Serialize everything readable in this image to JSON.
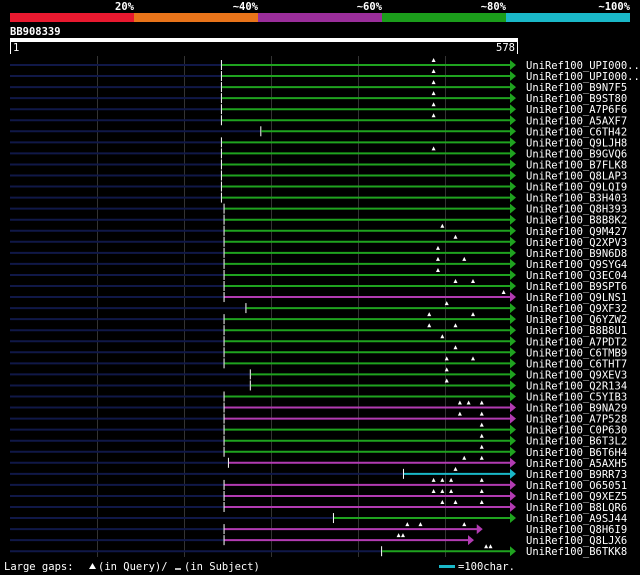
{
  "legend": {
    "ticks": [
      {
        "label": "20%",
        "color": "#e8192f"
      },
      {
        "label": "~40%",
        "color": "#e8741a"
      },
      {
        "label": "~60%",
        "color": "#9b2e9b"
      },
      {
        "label": "~80%",
        "color": "#1b9d1b"
      },
      {
        "label": "~100%",
        "color": "#1ab8c8"
      }
    ]
  },
  "query": {
    "name": "BB908339",
    "start": "1",
    "end": "578"
  },
  "footer": {
    "gaps_label": "Large gaps:",
    "in_query": "(in Query)/",
    "in_subject": "(in Subject)",
    "scale_label": "=100char.",
    "scale_color": "#1ab8c8"
  },
  "colors": {
    "green": "#1fa31f",
    "magenta": "#b23bb2",
    "cyan": "#1ab8c8",
    "navy": "#101848",
    "grid": "#333"
  },
  "chart_data": {
    "type": "alignment",
    "query_length": 578,
    "hits": [
      {
        "name": "UniRef100_UPI000..",
        "start": 242,
        "end": 578,
        "color": "green",
        "gaps": [
          485
        ]
      },
      {
        "name": "UniRef100_UPI000..",
        "start": 242,
        "end": 578,
        "color": "green",
        "gaps": [
          485
        ]
      },
      {
        "name": "UniRef100_B9N7F5",
        "start": 242,
        "end": 578,
        "color": "green",
        "gaps": [
          485
        ]
      },
      {
        "name": "UniRef100_B9ST80",
        "start": 242,
        "end": 578,
        "color": "green",
        "gaps": [
          485
        ]
      },
      {
        "name": "UniRef100_A7P6F6",
        "start": 242,
        "end": 578,
        "color": "green",
        "gaps": [
          485
        ]
      },
      {
        "name": "UniRef100_A5AXF7",
        "start": 242,
        "end": 578,
        "color": "green",
        "gaps": [
          485
        ]
      },
      {
        "name": "UniRef100_C6TH42",
        "start": 287,
        "end": 578,
        "color": "green",
        "gaps": []
      },
      {
        "name": "UniRef100_Q9LJH8",
        "start": 242,
        "end": 578,
        "color": "green",
        "gaps": []
      },
      {
        "name": "UniRef100_B9GVQ6",
        "start": 242,
        "end": 578,
        "color": "green",
        "gaps": [
          485
        ]
      },
      {
        "name": "UniRef100_B7FLK8",
        "start": 242,
        "end": 578,
        "color": "green",
        "gaps": []
      },
      {
        "name": "UniRef100_Q8LAP3",
        "start": 242,
        "end": 578,
        "color": "green",
        "gaps": []
      },
      {
        "name": "UniRef100_Q9LQI9",
        "start": 242,
        "end": 578,
        "color": "green",
        "gaps": []
      },
      {
        "name": "UniRef100_B3H403",
        "start": 242,
        "end": 578,
        "color": "green",
        "gaps": []
      },
      {
        "name": "UniRef100_Q8H393",
        "start": 245,
        "end": 578,
        "color": "green",
        "gaps": []
      },
      {
        "name": "UniRef100_B8B8K2",
        "start": 245,
        "end": 578,
        "color": "green",
        "gaps": []
      },
      {
        "name": "UniRef100_Q9M427",
        "start": 245,
        "end": 578,
        "color": "green",
        "gaps": [
          495
        ]
      },
      {
        "name": "UniRef100_Q2XPV3",
        "start": 245,
        "end": 578,
        "color": "green",
        "gaps": [
          510
        ]
      },
      {
        "name": "UniRef100_B9N6D8",
        "start": 245,
        "end": 578,
        "color": "green",
        "gaps": [
          490
        ]
      },
      {
        "name": "UniRef100_Q9SYG4",
        "start": 245,
        "end": 578,
        "color": "green",
        "gaps": [
          490,
          520
        ]
      },
      {
        "name": "UniRef100_Q3EC04",
        "start": 245,
        "end": 578,
        "color": "green",
        "gaps": [
          490
        ]
      },
      {
        "name": "UniRef100_B9SPT6",
        "start": 245,
        "end": 578,
        "color": "green",
        "gaps": [
          510,
          530
        ]
      },
      {
        "name": "UniRef100_Q9LNS1",
        "start": 245,
        "end": 578,
        "color": "magenta",
        "gaps": [
          565
        ]
      },
      {
        "name": "UniRef100_Q9XF32",
        "start": 270,
        "end": 578,
        "color": "green",
        "gaps": [
          500
        ]
      },
      {
        "name": "UniRef100_Q6YZW2",
        "start": 245,
        "end": 578,
        "color": "green",
        "gaps": [
          480,
          530
        ]
      },
      {
        "name": "UniRef100_B8B8U1",
        "start": 245,
        "end": 578,
        "color": "green",
        "gaps": [
          480,
          510
        ]
      },
      {
        "name": "UniRef100_A7PDT2",
        "start": 245,
        "end": 578,
        "color": "green",
        "gaps": [
          495
        ]
      },
      {
        "name": "UniRef100_C6TMB9",
        "start": 245,
        "end": 578,
        "color": "green",
        "gaps": [
          510
        ]
      },
      {
        "name": "UniRef100_C6THT7",
        "start": 245,
        "end": 578,
        "color": "green",
        "gaps": [
          500,
          530
        ]
      },
      {
        "name": "UniRef100_Q9XEV3",
        "start": 275,
        "end": 578,
        "color": "green",
        "gaps": [
          500
        ]
      },
      {
        "name": "UniRef100_Q2R134",
        "start": 275,
        "end": 578,
        "color": "green",
        "gaps": [
          500
        ]
      },
      {
        "name": "UniRef100_C5YIB3",
        "start": 245,
        "end": 578,
        "color": "green",
        "gaps": []
      },
      {
        "name": "UniRef100_B9NA29",
        "start": 245,
        "end": 578,
        "color": "magenta",
        "gaps": [
          515,
          525,
          540
        ]
      },
      {
        "name": "UniRef100_A7P528",
        "start": 245,
        "end": 578,
        "color": "magenta",
        "gaps": [
          515,
          540
        ]
      },
      {
        "name": "UniRef100_C0P630",
        "start": 245,
        "end": 578,
        "color": "green",
        "gaps": [
          540
        ]
      },
      {
        "name": "UniRef100_B6T3L2",
        "start": 245,
        "end": 578,
        "color": "green",
        "gaps": [
          540
        ]
      },
      {
        "name": "UniRef100_B6T6H4",
        "start": 245,
        "end": 578,
        "color": "green",
        "gaps": [
          540
        ]
      },
      {
        "name": "UniRef100_A5AXH5",
        "start": 250,
        "end": 578,
        "color": "magenta",
        "gaps": [
          520,
          540
        ]
      },
      {
        "name": "UniRef100_B9RR73",
        "start": 450,
        "end": 578,
        "color": "cyan",
        "gaps": [
          510
        ]
      },
      {
        "name": "UniRef100_O65051",
        "start": 245,
        "end": 578,
        "color": "magenta",
        "gaps": [
          485,
          495,
          505,
          540
        ]
      },
      {
        "name": "UniRef100_Q9XEZ5",
        "start": 245,
        "end": 578,
        "color": "magenta",
        "gaps": [
          485,
          495,
          505,
          540
        ]
      },
      {
        "name": "UniRef100_B8LQR6",
        "start": 245,
        "end": 578,
        "color": "magenta",
        "gaps": [
          495,
          510,
          540
        ]
      },
      {
        "name": "UniRef100_A9SJ44",
        "start": 370,
        "end": 578,
        "color": "green",
        "gaps": []
      },
      {
        "name": "UniRef100_Q8H6I9",
        "start": 245,
        "end": 540,
        "color": "magenta",
        "gaps": [
          455,
          470,
          520
        ]
      },
      {
        "name": "UniRef100_Q8LJX6",
        "start": 245,
        "end": 530,
        "color": "magenta",
        "gaps": [
          445,
          450
        ]
      },
      {
        "name": "UniRef100_B6TKK8",
        "start": 425,
        "end": 578,
        "color": "green",
        "gaps": [
          545,
          550
        ]
      }
    ]
  }
}
